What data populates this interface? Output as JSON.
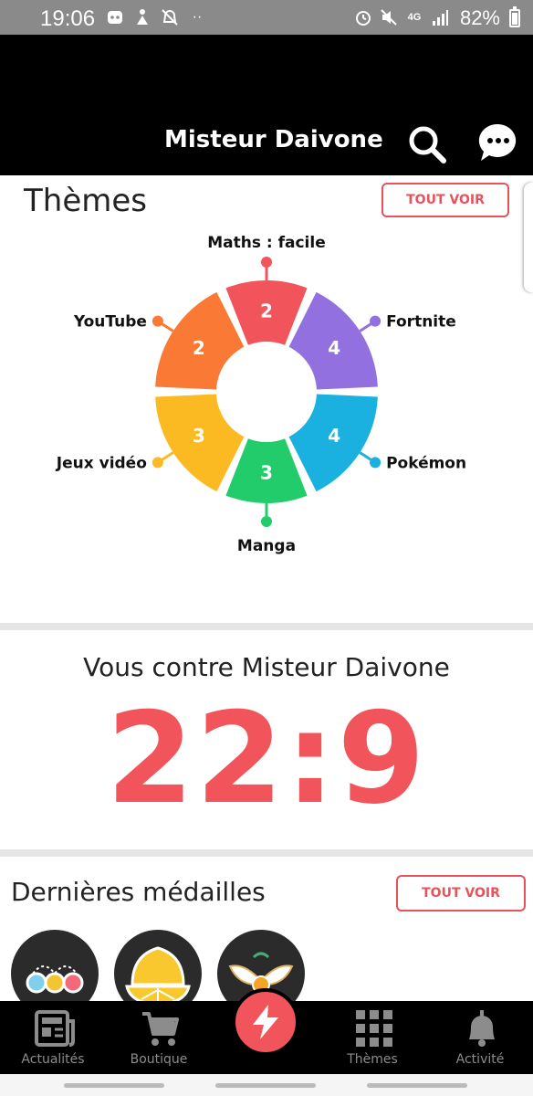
{
  "status_bar": {
    "time": "19:06",
    "network": "4G",
    "battery": "82%",
    "battery_level": 0.82
  },
  "header": {
    "title": "Misteur Daivone"
  },
  "themes": {
    "title": "Thèmes",
    "see_all": "TOUT VOIR",
    "segments": [
      {
        "label": "Maths : facile",
        "value": "2",
        "color": "#f2545b"
      },
      {
        "label": "Fortnite",
        "value": "4",
        "color": "#9370e0"
      },
      {
        "label": "Pokémon",
        "value": "4",
        "color": "#1ab0e0"
      },
      {
        "label": "Manga",
        "value": "3",
        "color": "#22cc6a"
      },
      {
        "label": "Jeux vidéo",
        "value": "3",
        "color": "#fbba22"
      },
      {
        "label": "YouTube",
        "value": "2",
        "color": "#fa7a35"
      }
    ]
  },
  "score": {
    "label": "Vous contre Misteur Daivone",
    "value": "22:9"
  },
  "medals": {
    "title": "Dernières médailles",
    "see_all": "TOUT VOIR"
  },
  "bottom_nav": {
    "news": "Actualités",
    "shop": "Boutique",
    "themes": "Thèmes",
    "activity": "Activité"
  }
}
